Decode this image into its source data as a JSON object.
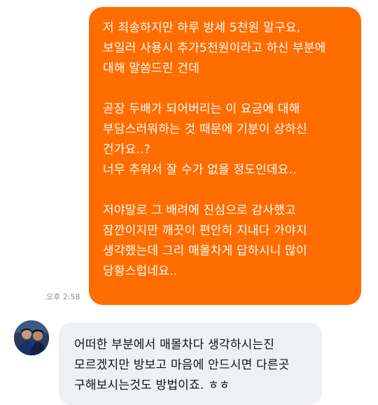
{
  "sent_message": {
    "lines": [
      "저 죄송하지만 하루 방세 5천원 말구요,",
      "보일러 사용시 추가5천원이라고 하신 부분에",
      "대해 말씀드린 건데",
      "",
      "곧장 두배가 되어버리는 이 요금에 대해",
      "부담스러워하는 것 때문에 기분이 상하신",
      "건가요..?",
      "너무 추워서 잘 수가 없을 정도인데요..",
      "",
      "저야말로 그 배려에 진심으로 감사했고",
      "잠깐이지만 깨끗이 편안히 지내다 가야지",
      "생각했는데 그리 매몰차게 답하시니 많이",
      "당황스럽네요.."
    ],
    "time": "오후 2:58",
    "bubble_color": "#ff6d00"
  },
  "received_message": {
    "avatar_icon": "profile-photo",
    "lines": [
      "어떠한 부분에서 매몰차다 생각하시는진",
      "모르겠지만 방보고 마음에 안드시면 다른곳",
      "구해보시는것도 방법이죠. ㅎㅎ"
    ],
    "bubble_color": "#eef0f3"
  }
}
